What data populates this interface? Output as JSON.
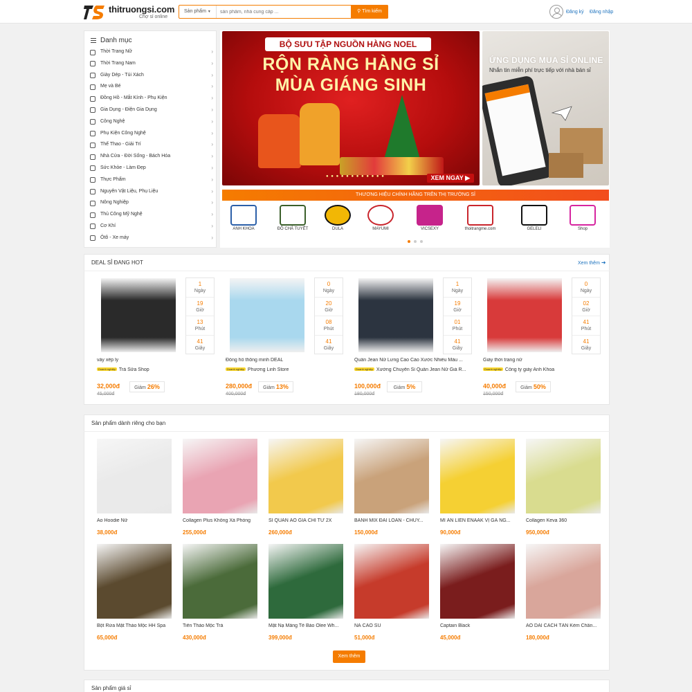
{
  "header": {
    "logo_text": "thitruongsi.com",
    "logo_sub": "Chợ sỉ online",
    "search_category": "Sản phẩm",
    "search_placeholder": "sản phẩm, nhà cung cấp ...",
    "search_button": "Tìm kiếm",
    "register": "Đăng ký",
    "login": "Đăng nhập"
  },
  "sidebar": {
    "title": "Danh mục",
    "items": [
      {
        "label": "Thời Trang Nữ",
        "icon": "dress-icon"
      },
      {
        "label": "Thời Trang Nam",
        "icon": "shirt-icon"
      },
      {
        "label": "Giày Dép - Túi Xách",
        "icon": "shoe-icon"
      },
      {
        "label": "Mẹ và Bé",
        "icon": "baby-icon"
      },
      {
        "label": "Đồng Hồ - Mắt Kính - Phụ Kiện",
        "icon": "watch-icon"
      },
      {
        "label": "Gia Dụng - Điện Gia Dụng",
        "icon": "pot-icon"
      },
      {
        "label": "Công Nghệ",
        "icon": "laptop-icon"
      },
      {
        "label": "Phụ Kiện Công Nghệ",
        "icon": "headphone-icon"
      },
      {
        "label": "Thể Thao - Giải Trí",
        "icon": "ball-icon"
      },
      {
        "label": "Nhà Cửa - Đời Sống - Bách Hóa",
        "icon": "home-icon"
      },
      {
        "label": "Sức Khỏe - Làm Đẹp",
        "icon": "lipstick-icon"
      },
      {
        "label": "Thực Phẩm",
        "icon": "food-icon"
      },
      {
        "label": "Nguyên Vật Liệu, Phụ Liệu",
        "icon": "material-icon"
      },
      {
        "label": "Nông Nghiệp",
        "icon": "plant-icon"
      },
      {
        "label": "Thủ Công Mỹ Nghệ",
        "icon": "craft-icon"
      },
      {
        "label": "Cơ Khí",
        "icon": "tool-icon"
      },
      {
        "label": "Ôtô - Xe máy",
        "icon": "car-icon"
      }
    ]
  },
  "banner_main": {
    "tag": "BỘ SƯU TẬP NGUỒN HÀNG NOEL",
    "line1": "RỘN RÀNG HÀNG SỈ",
    "line2": "MÙA GIÁNG SINH",
    "cta": "XEM NGAY"
  },
  "banner_side": {
    "title": "ỨNG DỤNG MUA SỈ ONLINE",
    "subtitle": "Nhắn tin miễn phí trực tiếp với nhà bán sỉ"
  },
  "brand_strip": "THƯƠNG HIỆU CHÍNH HÃNG TRÊN THỊ TRƯỜNG SỈ",
  "brands": [
    {
      "label": "ANH KHOA",
      "color": "#2b5fa8"
    },
    {
      "label": "ĐỒ CHẢ TUYẾT",
      "color": "#3a5f2a"
    },
    {
      "label": "DULA",
      "color": "#f2b705"
    },
    {
      "label": "MAYUMI",
      "color": "#c9252c"
    },
    {
      "label": "VICSEXY",
      "color": "#c6238b"
    },
    {
      "label": "thoitrangme.com",
      "color": "#c9252c"
    },
    {
      "label": "GELELI",
      "color": "#111111"
    },
    {
      "label": "Shop",
      "color": "#d6249f"
    }
  ],
  "deals": {
    "title": "DEAL SỈ ĐANG HOT",
    "see_more": "Xem thêm",
    "labels": {
      "day": "Ngày",
      "hour": "Giờ",
      "minute": "Phút",
      "second": "Giây",
      "discount": "Giảm",
      "business": "Doanh nghiệp"
    },
    "items": [
      {
        "name": "váy xếp ly",
        "shop": "Trà Sữa Shop",
        "price": "32,000đ",
        "old_price": "45,000đ",
        "discount": "26%",
        "days": "1",
        "hours": "19",
        "minutes": "13",
        "seconds": "41",
        "img_color": "#2a2a2a"
      },
      {
        "name": "Đồng hồ thông minh DEAL",
        "shop": "Phương Linh Store",
        "price": "280,000đ",
        "old_price": "400,000đ",
        "discount": "13%",
        "days": "0",
        "hours": "20",
        "minutes": "08",
        "seconds": "41",
        "img_color": "#a9d8ee"
      },
      {
        "name": "Quần Jean Nữ Lưng Cao Cào Xước Nhiều Màu ...",
        "shop": "Xưởng Chuyên Sỉ Quần Jean Nữ Giá R...",
        "price": "100,000đ",
        "old_price": "180,000đ",
        "discount": "5%",
        "days": "1",
        "hours": "19",
        "minutes": "01",
        "seconds": "41",
        "img_color": "#2c3440"
      },
      {
        "name": "Giày thời trang nữ",
        "shop": "Công ty giày Anh Khoa",
        "price": "40,000đ",
        "old_price": "150,000đ",
        "discount": "50%",
        "days": "0",
        "hours": "02",
        "minutes": "41",
        "seconds": "41",
        "img_color": "#d83a3a"
      }
    ]
  },
  "for_you": {
    "title": "Sản phẩm dành riêng cho bạn",
    "more_button": "Xem thêm",
    "items": [
      {
        "name": "Áo Hoodie Nữ",
        "price": "38,000đ",
        "img_color": "#eaeaea"
      },
      {
        "name": "Collagen Plus Không Xà Phòng",
        "price": "255,000đ",
        "img_color": "#e9a4b3"
      },
      {
        "name": "SỈ QUẦN ÁO GIÁ CHỈ TỪ 2X",
        "price": "260,000đ",
        "img_color": "#f2c94c"
      },
      {
        "name": "BÁNH MIX ĐÀI LOAN - CHUY...",
        "price": "150,000đ",
        "img_color": "#c9a27a"
      },
      {
        "name": "MÌ ĂN LIỀN ENAAK VỊ GÀ NG...",
        "price": "90,000đ",
        "img_color": "#f5d033"
      },
      {
        "name": "Collagen Keva 360",
        "price": "950,000đ",
        "img_color": "#d9dc8f"
      },
      {
        "name": "Bột Rửa Mặt Thảo Mộc HH Spa",
        "price": "65,000đ",
        "img_color": "#5b4a2f"
      },
      {
        "name": "Tiên Thảo Mộc Trà",
        "price": "430,000đ",
        "img_color": "#4b6b3a"
      },
      {
        "name": "Mặt Nạ Mầng Tế Bào Olee Wh...",
        "price": "399,000đ",
        "img_color": "#2e6a3c"
      },
      {
        "name": "NÁ CAO SU",
        "price": "51,000đ",
        "img_color": "#c63b2b"
      },
      {
        "name": "Captain Black",
        "price": "45,000đ",
        "img_color": "#7a1d1d"
      },
      {
        "name": "ÁO DÀI CÁCH TÂN Kèm Chân...",
        "price": "180,000đ",
        "img_color": "#d9a69b"
      }
    ]
  },
  "wholesale": {
    "title": "Sản phẩm giá sỉ"
  },
  "colors": {
    "accent": "#f57c00",
    "link": "#1e73be"
  }
}
